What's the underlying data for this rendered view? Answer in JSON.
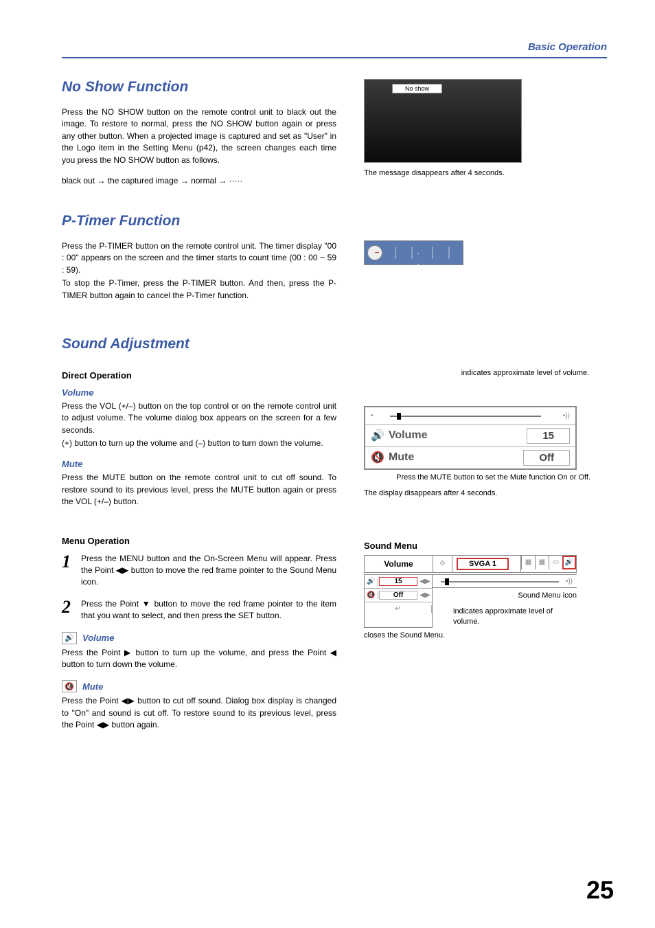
{
  "header": {
    "title": "Basic Operation"
  },
  "noshow": {
    "heading": "No Show Function",
    "body": "Press the NO SHOW button on the remote control unit to black out the image.  To restore to normal, press the NO SHOW button again or press any other button.  When a projected image is captured and set as \"User\" in the Logo item in the Setting Menu (p42), the screen changes each time you press the NO SHOW button as follows.",
    "sequence": "black out → the captured image → normal → ·····",
    "osd_label": "No show",
    "caption": "The message disappears after 4 seconds."
  },
  "ptimer": {
    "heading": "P-Timer Function",
    "body1": "Press the P-TIMER button on the remote control unit.  The timer display \"00 : 00\" appears on the screen and the timer starts to count time (00 : 00 ~ 59 : 59).",
    "body2": "To stop the P-Timer, press the P-TIMER button.  And then, press the P-TIMER button again to cancel the  P-Timer function."
  },
  "sound": {
    "heading": "Sound Adjustment",
    "direct": {
      "title": "Direct Operation",
      "volume": {
        "label": "Volume",
        "p1": "Press the VOL (+/–) button on the top control or on the remote control unit to adjust volume.  The volume dialog box appears on the screen for a few seconds.",
        "p2": "(+) button to turn up the volume and (–) button to turn down the volume."
      },
      "mute": {
        "label": "Mute",
        "p1": "Press the MUTE button on the remote control unit to cut off sound.  To restore sound to its previous level, press the MUTE button again or press the VOL (+/–) button."
      }
    },
    "menu": {
      "title": "Menu Operation",
      "step1_num": "1",
      "step1": "Press the MENU button and the On-Screen Menu will appear.  Press the Point ◀▶ button to move the red frame pointer to the Sound Menu icon.",
      "step2_num": "2",
      "step2": "Press the Point ▼ button to move the red frame pointer to the item that you want to select, and then press the SET button.",
      "volume": {
        "label": "Volume",
        "body": "Press the Point ▶ button to turn up the volume, and press the Point ◀ button to turn down the volume."
      },
      "mute": {
        "label": "Mute",
        "body": "Press the Point ◀▶ button to cut off sound.  Dialog box display is changed to \"On\" and sound is cut off.  To restore sound to its previous level, press the Point ◀▶ button again."
      }
    },
    "osd": {
      "approx_label": "indicates approximate level of volume.",
      "volume_label": "Volume",
      "volume_value": "15",
      "mute_label": "Mute",
      "mute_value": "Off",
      "mute_caption": "Press the MUTE button to set the Mute function On or Off.",
      "disappear_caption": "The display disappears after 4 seconds."
    },
    "sound_menu": {
      "title": "Sound Menu",
      "tab_label": "Volume",
      "svga": "SVGA 1",
      "row_vol": "15",
      "row_mute": "Off",
      "icon_label": "Sound Menu icon",
      "approx_label": "indicates approximate level of volume.",
      "close_label": "closes the Sound Menu."
    }
  },
  "page_number": "25"
}
